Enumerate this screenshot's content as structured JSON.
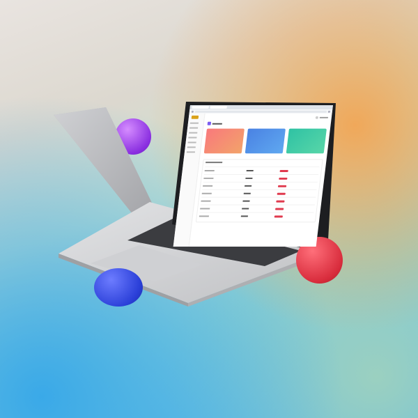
{
  "scene": {
    "description_free": true,
    "colors": {
      "purple_ball": "#8a2fe0",
      "blue_ball": "#2a3fd8",
      "red_ball": "#d82c3c",
      "laptop_body": "#c9cacd"
    }
  },
  "laptop": {
    "screen_app": {
      "sidebar_items": 7,
      "summary_cards": [
        {
          "color": "#f9797c"
        },
        {
          "color": "#4a82e3"
        },
        {
          "color": "#2fc2a4"
        }
      ],
      "table_rows": 7,
      "badge_color": "#e03a4e"
    }
  }
}
